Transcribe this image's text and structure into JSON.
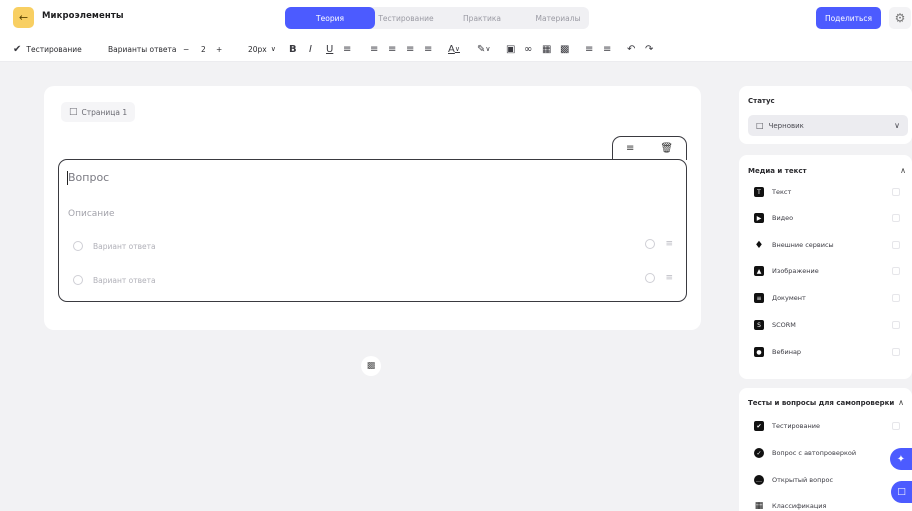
{
  "header": {
    "back_icon": "arrow-left-icon",
    "title": "Микроэлементы",
    "tabs": [
      {
        "label": "Теория",
        "active": true
      },
      {
        "label": "Тестирование",
        "active": false
      },
      {
        "label": "Практика",
        "active": false
      },
      {
        "label": "Материалы",
        "active": false
      }
    ],
    "share_label": "Поделиться",
    "settings_icon": "gear-icon",
    "accent_color": "#4c5bff",
    "back_color": "#f8cf62"
  },
  "toolbar": {
    "block_type": "Тестирование",
    "answers_label": "Варианты ответа",
    "minus": "−",
    "answers_count": "2",
    "plus": "+",
    "font_size": "20px"
  },
  "editor": {
    "page_label": "Страница 1",
    "question_placeholder": "Вопрос",
    "description_placeholder": "Описание",
    "options": [
      {
        "label": "Вариант ответа"
      },
      {
        "label": "Вариант ответа"
      }
    ]
  },
  "sidebar": {
    "status_title": "Статус",
    "status_value": "Черновик",
    "media_title": "Медиа и текст",
    "media_items": [
      {
        "label": "Текст"
      },
      {
        "label": "Видео"
      },
      {
        "label": "Внешние сервисы"
      },
      {
        "label": "Изображение"
      },
      {
        "label": "Документ"
      },
      {
        "label": "SCORM"
      },
      {
        "label": "Вебинар"
      }
    ],
    "tests_title": "Тесты и вопросы для самопроверки",
    "test_items": [
      {
        "label": "Тестирование"
      },
      {
        "label": "Вопрос с автопроверкой"
      },
      {
        "label": "Открытый вопрос"
      },
      {
        "label": "Классификация"
      }
    ]
  }
}
